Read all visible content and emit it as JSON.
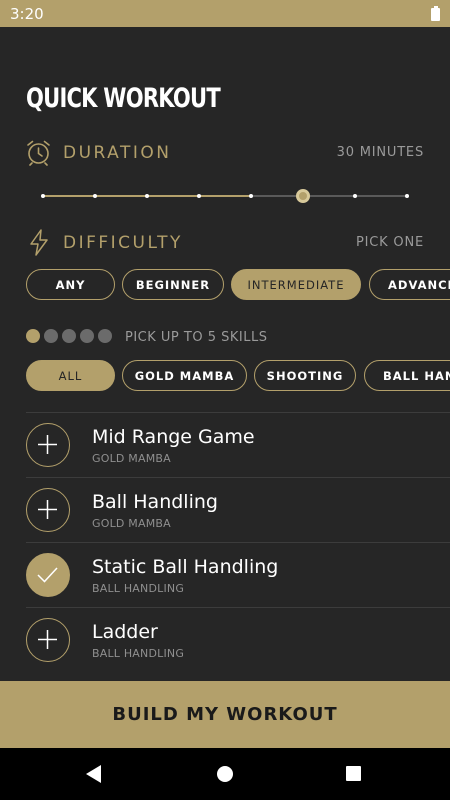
{
  "status_bar": {
    "time": "3:20"
  },
  "title": "QUICK WORKOUT",
  "duration": {
    "label": "DURATION",
    "value": "30 MINUTES",
    "level": 0.571,
    "steps": 8,
    "selected_step": 5
  },
  "difficulty": {
    "label": "DIFFICULTY",
    "hint": "PICK ONE",
    "options": [
      "ANY",
      "BEGINNER",
      "INTERMEDIATE",
      "ADVANCED"
    ],
    "selected": "INTERMEDIATE"
  },
  "skills": {
    "hint": "PICK UP TO 5 SKILLS",
    "picked": 1,
    "max": 5,
    "filters": [
      "ALL",
      "GOLD MAMBA",
      "SHOOTING",
      "BALL HANDLING"
    ],
    "selected_filter": "ALL"
  },
  "workouts": [
    {
      "title": "Mid Range Game",
      "category": "GOLD MAMBA",
      "selected": false
    },
    {
      "title": "Ball Handling",
      "category": "GOLD MAMBA",
      "selected": false
    },
    {
      "title": "Static Ball Handling",
      "category": "BALL HANDLING",
      "selected": true
    },
    {
      "title": "Ladder",
      "category": "BALL HANDLING",
      "selected": false
    }
  ],
  "build_button": "BUILD MY WORKOUT",
  "colors": {
    "accent": "#b3a06b",
    "background": "#262626",
    "muted": "#9a9a9a",
    "nav": "#000000"
  },
  "icons": {
    "duration": "alarm-clock-icon",
    "difficulty": "lightning-bolt-icon",
    "add": "plus-icon",
    "selected": "checkmark-icon"
  }
}
